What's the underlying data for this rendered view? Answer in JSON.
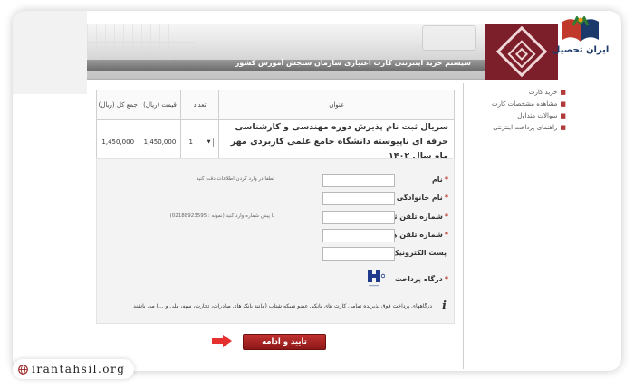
{
  "banner": {
    "title": "سیستم خرید اینترنتی کارت اعتباری سازمان سنجش آموزش کشور"
  },
  "brand": {
    "name": "ایران تحصیل"
  },
  "sidebar": {
    "items": [
      {
        "label": "خرید کارت"
      },
      {
        "label": "مشاهده مشخصات کارت"
      },
      {
        "label": "سوالات متداول"
      },
      {
        "label": "راهنمای پرداخت اینترنتی"
      }
    ]
  },
  "table": {
    "headers": {
      "title": "عنوان",
      "qty": "تعداد",
      "price": "قیمت (ریال)",
      "total": "جمع کل (ریال)"
    },
    "row": {
      "title": "سریال ثبت نام پذیرش دوره مهندسی و کارشناسی حرفه ای ناپیوسته دانشگاه جامع علمی کاربردی مهر ماه سال ۱۴۰۲",
      "qty": "1",
      "price": "1,450,000",
      "total": "1,450,000"
    }
  },
  "form": {
    "fields": [
      {
        "label": "نام",
        "required": "*",
        "hint": "لطفا در وارد کردن اطلاعات دقت کنید"
      },
      {
        "label": "نام خانوادگی",
        "required": "*",
        "hint": ""
      },
      {
        "label": "شماره تلفن ثابت",
        "required": "*",
        "hint": "با پیش شماره وارد کنید (نمونه : 02188923595)"
      },
      {
        "label": "شماره تلفن همراه",
        "required": "*",
        "hint": ""
      },
      {
        "label": "پست الکترونیک",
        "required": "",
        "hint": ""
      }
    ],
    "gateway_label": "درگاه پرداخت",
    "gateway_required": "*",
    "note": "درگاههای پرداخت فوق پذیرنده تمامی کارت های بانکی عضو شبکه شتاب (مانند بانک های صادرات، تجارت، سپه، ملی و ...) می باشند"
  },
  "submit": {
    "label": "تایید و ادامه"
  },
  "footer": {
    "url": "irantahsil.org"
  },
  "colors": {
    "accent": "#9b1c1c",
    "logo_bg": "#7d1f2a",
    "bank_blue": "#1f3a8a"
  }
}
